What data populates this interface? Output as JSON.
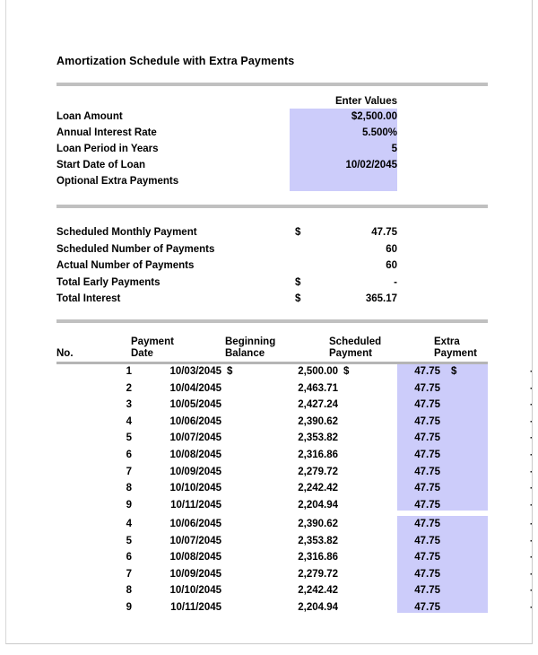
{
  "document": {
    "title": "Amortization Schedule with Extra Payments"
  },
  "colors": {
    "input_highlight": "#ccccfa",
    "rule": "#c0c0c0",
    "text": "#000000"
  },
  "inputs": {
    "header": "Enter Values",
    "rows": [
      {
        "label": "Loan Amount",
        "value": "$2,500.00"
      },
      {
        "label": "Annual Interest Rate",
        "value": "5.500%"
      },
      {
        "label": "Loan Period in Years",
        "value": "5"
      },
      {
        "label": "Start Date of Loan",
        "value": "10/02/2045"
      },
      {
        "label": "Optional Extra Payments",
        "value": ""
      }
    ]
  },
  "summary": {
    "rows": [
      {
        "label": "Scheduled Monthly Payment",
        "currency": "$",
        "value": "47.75"
      },
      {
        "label": "Scheduled Number of Payments",
        "currency": "",
        "value": "60"
      },
      {
        "label": "Actual Number of Payments",
        "currency": "",
        "value": "60"
      },
      {
        "label": "Total Early Payments",
        "currency": "$",
        "value": "-"
      },
      {
        "label": "Total Interest",
        "currency": "$",
        "value": "365.17"
      }
    ]
  },
  "schedule": {
    "columns": {
      "no": "No.",
      "date": "Payment\nDate",
      "balance": "Beginning\nBalance",
      "payment": "Scheduled\nPayment",
      "extra": "Extra\nPayment"
    },
    "block1": [
      {
        "no": "1",
        "date": "10/03/2045",
        "cur1": "$",
        "balance": "2,500.00",
        "cur2": "$",
        "payment": "47.75",
        "cur3": "$",
        "extra": "-"
      },
      {
        "no": "2",
        "date": "10/04/2045",
        "cur1": "",
        "balance": "2,463.71",
        "cur2": "",
        "payment": "47.75",
        "cur3": "",
        "extra": "-"
      },
      {
        "no": "3",
        "date": "10/05/2045",
        "cur1": "",
        "balance": "2,427.24",
        "cur2": "",
        "payment": "47.75",
        "cur3": "",
        "extra": "-"
      },
      {
        "no": "4",
        "date": "10/06/2045",
        "cur1": "",
        "balance": "2,390.62",
        "cur2": "",
        "payment": "47.75",
        "cur3": "",
        "extra": "-"
      },
      {
        "no": "5",
        "date": "10/07/2045",
        "cur1": "",
        "balance": "2,353.82",
        "cur2": "",
        "payment": "47.75",
        "cur3": "",
        "extra": "-"
      },
      {
        "no": "6",
        "date": "10/08/2045",
        "cur1": "",
        "balance": "2,316.86",
        "cur2": "",
        "payment": "47.75",
        "cur3": "",
        "extra": "-"
      },
      {
        "no": "7",
        "date": "10/09/2045",
        "cur1": "",
        "balance": "2,279.72",
        "cur2": "",
        "payment": "47.75",
        "cur3": "",
        "extra": "-"
      },
      {
        "no": "8",
        "date": "10/10/2045",
        "cur1": "",
        "balance": "2,242.42",
        "cur2": "",
        "payment": "47.75",
        "cur3": "",
        "extra": "-"
      },
      {
        "no": "9",
        "date": "10/11/2045",
        "cur1": "",
        "balance": "2,204.94",
        "cur2": "",
        "payment": "47.75",
        "cur3": "",
        "extra": "-"
      }
    ],
    "block2": [
      {
        "no": "4",
        "date": "10/06/2045",
        "cur1": "",
        "balance": "2,390.62",
        "cur2": "",
        "payment": "47.75",
        "cur3": "",
        "extra": "-"
      },
      {
        "no": "5",
        "date": "10/07/2045",
        "cur1": "",
        "balance": "2,353.82",
        "cur2": "",
        "payment": "47.75",
        "cur3": "",
        "extra": "-"
      },
      {
        "no": "6",
        "date": "10/08/2045",
        "cur1": "",
        "balance": "2,316.86",
        "cur2": "",
        "payment": "47.75",
        "cur3": "",
        "extra": "-"
      },
      {
        "no": "7",
        "date": "10/09/2045",
        "cur1": "",
        "balance": "2,279.72",
        "cur2": "",
        "payment": "47.75",
        "cur3": "",
        "extra": "-"
      },
      {
        "no": "8",
        "date": "10/10/2045",
        "cur1": "",
        "balance": "2,242.42",
        "cur2": "",
        "payment": "47.75",
        "cur3": "",
        "extra": "-"
      },
      {
        "no": "9",
        "date": "10/11/2045",
        "cur1": "",
        "balance": "2,204.94",
        "cur2": "",
        "payment": "47.75",
        "cur3": "",
        "extra": "-"
      }
    ]
  }
}
